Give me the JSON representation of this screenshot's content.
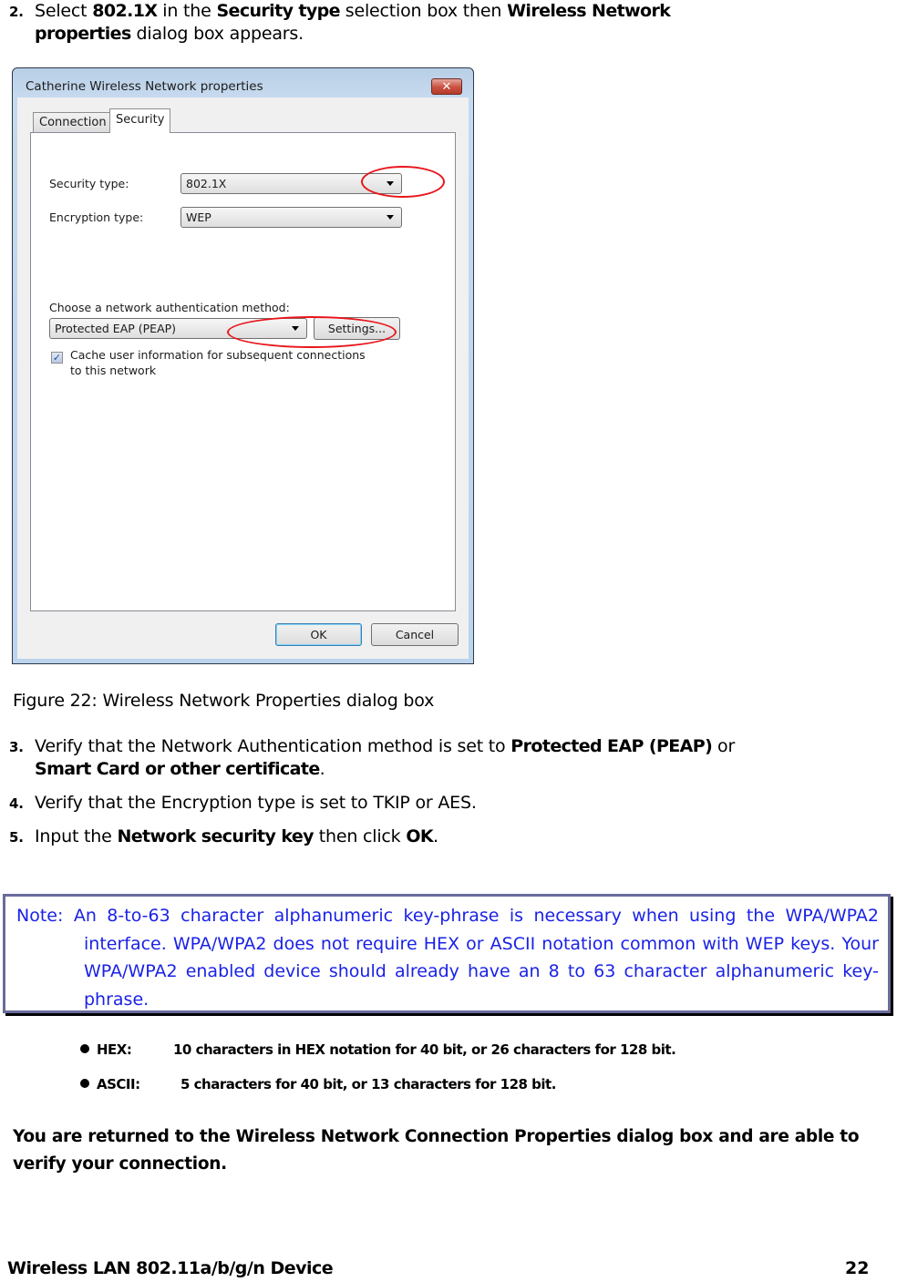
{
  "step2": {
    "num": "2.",
    "t1": "Select ",
    "b1": "802.1X",
    "t2": " in the ",
    "b2": "Security type",
    "t3": " selection box then ",
    "b3": "Wireless Network",
    "b4": "properties",
    "t4": " dialog box appears."
  },
  "dialog": {
    "title": "Catherine Wireless Network properties",
    "close_label": "✕",
    "tabs": [
      {
        "label": "Connection",
        "active": false
      },
      {
        "label": "Security",
        "active": true
      }
    ],
    "security_type_label": "Security type:",
    "security_type_value": "802.1X",
    "encryption_type_label": "Encryption type:",
    "encryption_type_value": "WEP",
    "auth_method_label": "Choose a network authentication method:",
    "auth_method_value": "Protected EAP (PEAP)",
    "settings_label": "Settings...",
    "cache_checked": true,
    "cache_label_line1": "Cache user information for subsequent connections",
    "cache_label_line2": "to this network",
    "ok_label": "OK",
    "cancel_label": "Cancel",
    "highlight_color": "#e8141a"
  },
  "caption": "Figure 22: Wireless Network Properties dialog box",
  "step3": {
    "num": "3.",
    "t1": "Verify that the Network Authentication method is set to ",
    "b1": "Protected EAP (PEAP)",
    "t2": " or",
    "b2": "Smart Card or other certificate",
    "t3": "."
  },
  "step4": {
    "num": "4.",
    "t1": "Verify that the Encryption type is set to TKIP or AES."
  },
  "step5": {
    "num": "5.",
    "t1": "Input the ",
    "b1": "Network security key",
    "t2": " then click ",
    "b2": "OK",
    "t3": "."
  },
  "note": {
    "text": "Note: An 8-to-63 character alphanumeric key-phrase is necessary when using the WPA/WPA2 interface. WPA/WPA2 does not require HEX or ASCII notation common with WEP keys. Your WPA/WPA2 enabled device should already have an 8 to 63 character alphanumeric key-phrase.",
    "color": "#1a22e6",
    "border_color": "#6a6b9c"
  },
  "bullets": [
    {
      "key": "HEX:",
      "text": "10 characters in HEX notation for 40 bit, or 26 characters for 128 bit."
    },
    {
      "key": "ASCII:",
      "text": "5 characters for 40 bit, or 13 characters for 128 bit."
    }
  ],
  "final_text": "You are returned to the Wireless Network Connection Properties dialog box and are able to verify your connection.",
  "footer": {
    "title": "Wireless LAN 802.11a/b/g/n Device",
    "page": "22"
  }
}
